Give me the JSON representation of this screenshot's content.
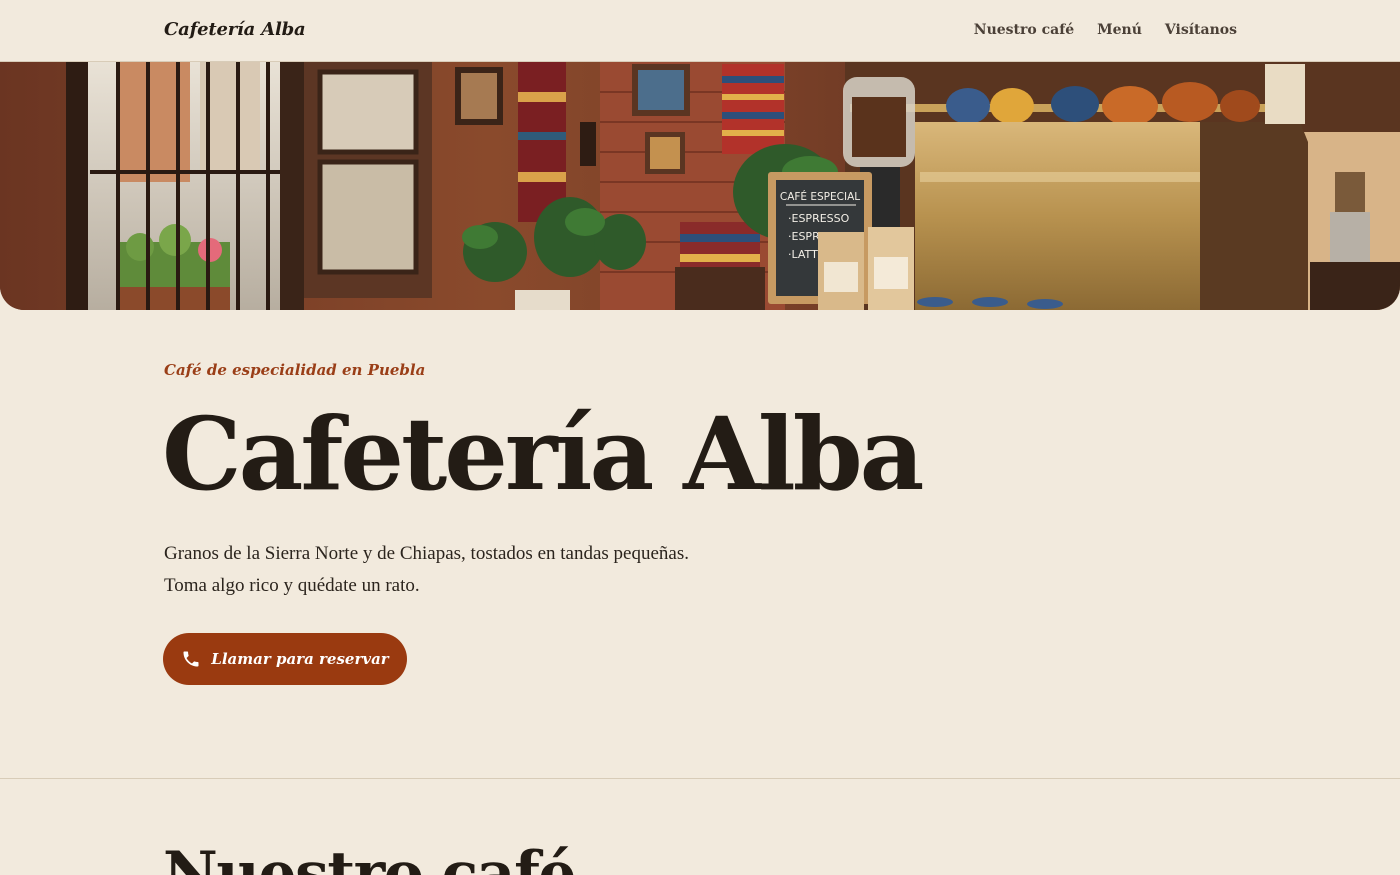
{
  "header": {
    "brand": "Cafetería Alba",
    "nav": [
      {
        "label": "Nuestro café"
      },
      {
        "label": "Menú"
      },
      {
        "label": "Visítanos"
      }
    ]
  },
  "hero_image": {
    "chalkboard_title": "CAFÉ ESPECIAL",
    "chalkboard_items": [
      "·ESPRESSO",
      "·ESPRESSO",
      "·LATTE"
    ]
  },
  "hero": {
    "eyebrow": "Café de especialidad en Puebla",
    "title": "Cafetería Alba",
    "lead": "Granos de la Sierra Norte y de Chiapas, tostados en tandas pequeñas. Toma algo rico y quédate un rato.",
    "cta_label": "Llamar para reservar",
    "cta_icon": "phone-icon"
  },
  "next_section": {
    "title": "Nuestro café"
  },
  "colors": {
    "background": "#f2eadd",
    "text": "#231c15",
    "accent": "#9a3a10",
    "eyebrow": "#9a3e17"
  }
}
